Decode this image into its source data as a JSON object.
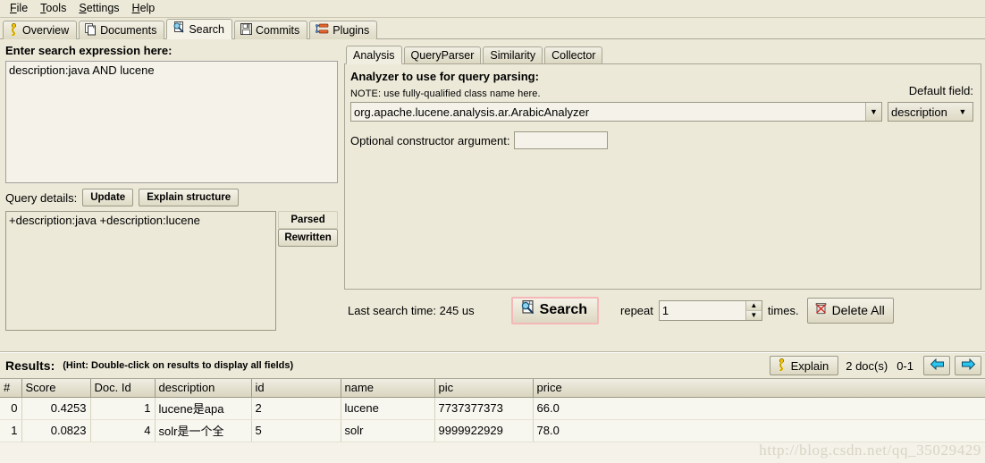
{
  "menu": {
    "items": [
      {
        "label": "File",
        "mnemonic": "F"
      },
      {
        "label": "Tools",
        "mnemonic": "T"
      },
      {
        "label": "Settings",
        "mnemonic": "S"
      },
      {
        "label": "Help",
        "mnemonic": "H"
      }
    ]
  },
  "main_tabs": [
    {
      "label": "Overview",
      "icon": "person-yellow-icon",
      "selected": false
    },
    {
      "label": "Documents",
      "icon": "documents-icon",
      "selected": false
    },
    {
      "label": "Search",
      "icon": "magnifier-document-icon",
      "selected": true
    },
    {
      "label": "Commits",
      "icon": "floppy-disk-icon",
      "selected": false
    },
    {
      "label": "Plugins",
      "icon": "plugins-icon",
      "selected": false
    }
  ],
  "left": {
    "search_expression_label": "Enter search expression here:",
    "search_expression_value": "description:java AND lucene",
    "query_details_label": "Query details:",
    "update_button": "Update",
    "explain_structure_button": "Explain structure",
    "parsed_query_value": "+description:java +description:lucene",
    "parsed_button": "Parsed",
    "rewritten_button": "Rewritten"
  },
  "right": {
    "tabs": [
      {
        "label": "Analysis",
        "selected": true
      },
      {
        "label": "QueryParser",
        "selected": false
      },
      {
        "label": "Similarity",
        "selected": false
      },
      {
        "label": "Collector",
        "selected": false
      }
    ],
    "analyzer_heading": "Analyzer to use for query parsing:",
    "analyzer_note": "NOTE: use fully-qualified class name here.",
    "analyzer_value": "org.apache.lucene.analysis.ar.ArabicAnalyzer",
    "default_field_label": "Default field:",
    "default_field_value": "description",
    "ctor_label": "Optional constructor argument:",
    "ctor_value": ""
  },
  "actions": {
    "last_search_time": "Last search time: 245 us",
    "search_button": "Search",
    "search_icon": "magnifier-document-icon",
    "search_button_border_color": "#f5b7b7",
    "repeat_label": "repeat",
    "repeat_value": "1",
    "times_label": "times.",
    "delete_all_button": "Delete All",
    "delete_all_icon": "trash-crossed-icon"
  },
  "results": {
    "title": "Results:",
    "hint": "(Hint: Double-click on results to display all fields)",
    "explain_button": "Explain",
    "explain_icon": "person-yellow-icon",
    "doc_count": "2 doc(s)",
    "range": "0-1",
    "prev_icon": "arrow-left-icon",
    "next_icon": "arrow-right-icon",
    "columns": [
      "#",
      "Score",
      "Doc. Id",
      "description",
      "id",
      "name",
      "pic",
      "price"
    ],
    "rows": [
      {
        "num": "0",
        "score": "0.4253",
        "doc_id": "1",
        "description": "lucene是apa",
        "id": "2",
        "name": "lucene",
        "pic": "7737377373",
        "price": "66.0"
      },
      {
        "num": "1",
        "score": "0.0823",
        "doc_id": "4",
        "description": "solr是一个全",
        "id": "5",
        "name": "solr",
        "pic": "9999922929",
        "price": "78.0"
      }
    ],
    "watermark": "http://blog.csdn.net/qq_35029429"
  }
}
